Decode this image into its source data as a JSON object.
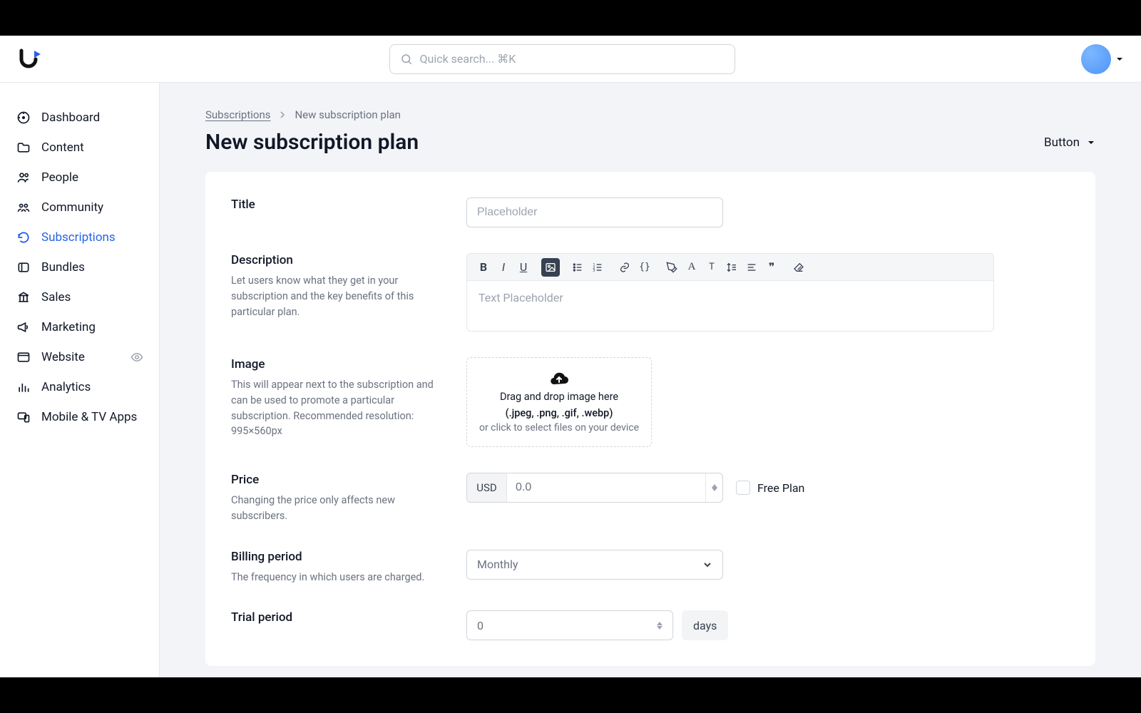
{
  "search": {
    "placeholder": "Quick search... ⌘K"
  },
  "sidebar": {
    "items": [
      {
        "label": "Dashboard"
      },
      {
        "label": "Content"
      },
      {
        "label": "People"
      },
      {
        "label": "Community"
      },
      {
        "label": "Subscriptions"
      },
      {
        "label": "Bundles"
      },
      {
        "label": "Sales"
      },
      {
        "label": "Marketing"
      },
      {
        "label": "Website"
      },
      {
        "label": "Analytics"
      },
      {
        "label": "Mobile & TV Apps"
      }
    ]
  },
  "breadcrumb": {
    "parent": "Subscriptions",
    "current": "New subscription plan"
  },
  "page": {
    "title": "New subscription plan",
    "action_button": "Button"
  },
  "form": {
    "title": {
      "label": "Title",
      "placeholder": "Placeholder"
    },
    "description": {
      "label": "Description",
      "help": "Let users know what they get in your subscription and the key benefits of this particular plan.",
      "placeholder": "Text Placeholder"
    },
    "image": {
      "label": "Image",
      "help": "This will appear next to the subscription and can be used to promote a particular subscription. Recommended resolution: 995×560px",
      "drop_title": "Drag and drop image here",
      "drop_formats": "(.jpeg, .png, .gif, .webp)",
      "drop_sub": "or click to select files on your device"
    },
    "price": {
      "label": "Price",
      "help": "Changing the price only affects new subscribers.",
      "currency": "USD",
      "value": "0.0",
      "free_label": "Free Plan"
    },
    "billing": {
      "label": "Billing period",
      "help": "The frequency in which users are charged.",
      "value": "Monthly"
    },
    "trial": {
      "label": "Trial period",
      "value": "0",
      "unit": "days"
    }
  }
}
